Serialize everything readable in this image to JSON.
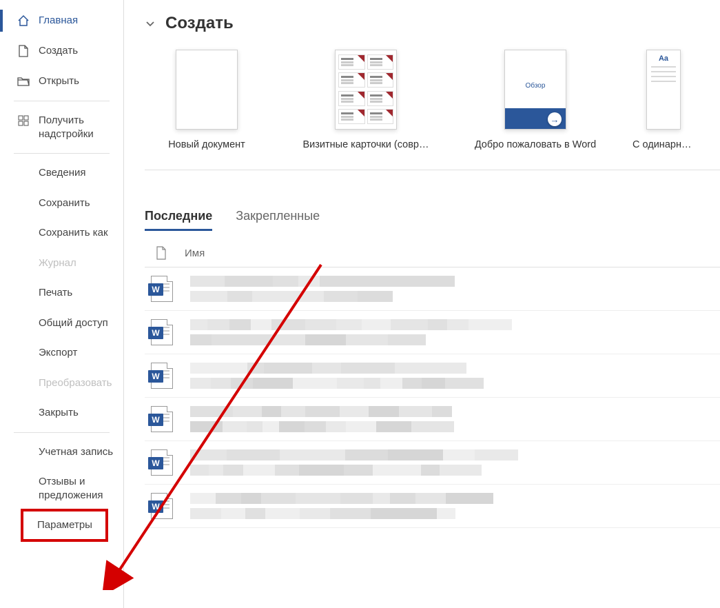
{
  "sidebar": {
    "items": [
      {
        "label": "Главная",
        "icon": "home",
        "active": true
      },
      {
        "label": "Создать",
        "icon": "document"
      },
      {
        "label": "Открыть",
        "icon": "folder"
      }
    ],
    "addins": {
      "label": "Получить надстройки",
      "icon": "grid"
    },
    "secondary": [
      {
        "label": "Сведения"
      },
      {
        "label": "Сохранить"
      },
      {
        "label": "Сохранить как"
      },
      {
        "label": "Журнал",
        "disabled": true
      },
      {
        "label": "Печать"
      },
      {
        "label": "Общий доступ"
      },
      {
        "label": "Экспорт"
      },
      {
        "label": "Преобразовать",
        "disabled": true
      },
      {
        "label": "Закрыть"
      }
    ],
    "bottom": [
      {
        "label": "Учетная запись"
      },
      {
        "label": "Отзывы и предложения"
      },
      {
        "label": "Параметры",
        "highlight": true
      }
    ]
  },
  "main": {
    "create_title": "Создать",
    "templates": [
      {
        "label": "Новый документ",
        "kind": "blank"
      },
      {
        "label": "Визитные карточки (совр…",
        "kind": "cards"
      },
      {
        "label": "Добро пожаловать в Word",
        "kind": "welcome",
        "welcome_text": "Обзор"
      },
      {
        "label": "С одинарным ",
        "kind": "spacing",
        "aa": "Aa"
      }
    ],
    "tabs": [
      {
        "label": "Последние",
        "active": true
      },
      {
        "label": "Закрепленные"
      }
    ],
    "list_header": "Имя",
    "recent_count": 6
  }
}
